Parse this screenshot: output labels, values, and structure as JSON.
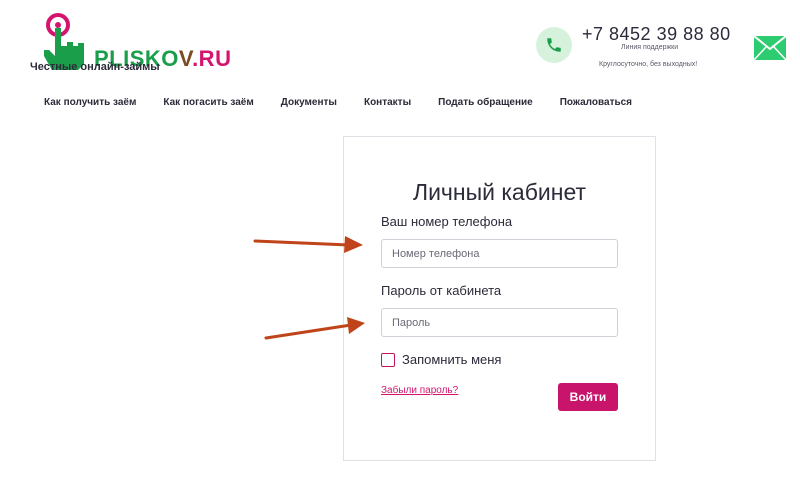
{
  "brand": {
    "name_part1": "PLISKO",
    "name_part2": "V",
    "name_part3": ".RU",
    "tagline": "Честные онлайн-займы",
    "colors": {
      "green": "#1a9e4a",
      "brown": "#7a4a22",
      "pink": "#d4146f"
    }
  },
  "contact": {
    "phone": "+7 8452 39 88 80",
    "support_line": "Линия поддержки",
    "hours": "Круглосуточно, без выходных!",
    "phone_icon": "phone-icon",
    "mail_icon": "mail-icon"
  },
  "nav": {
    "items": [
      "Как получить заём",
      "Как погасить заём",
      "Документы",
      "Контакты",
      "Подать обращение",
      "Пожаловаться"
    ]
  },
  "login": {
    "title": "Личный кабинет",
    "phone_label": "Ваш номер телефона",
    "phone_placeholder": "Номер телефона",
    "phone_value": "",
    "password_label": "Пароль от кабинета",
    "password_placeholder": "Пароль",
    "password_value": "",
    "remember_label": "Запомнить меня",
    "remember_checked": false,
    "forgot_link": "Забыли пароль?",
    "submit_label": "Войти",
    "accent_color": "#c8146a"
  }
}
